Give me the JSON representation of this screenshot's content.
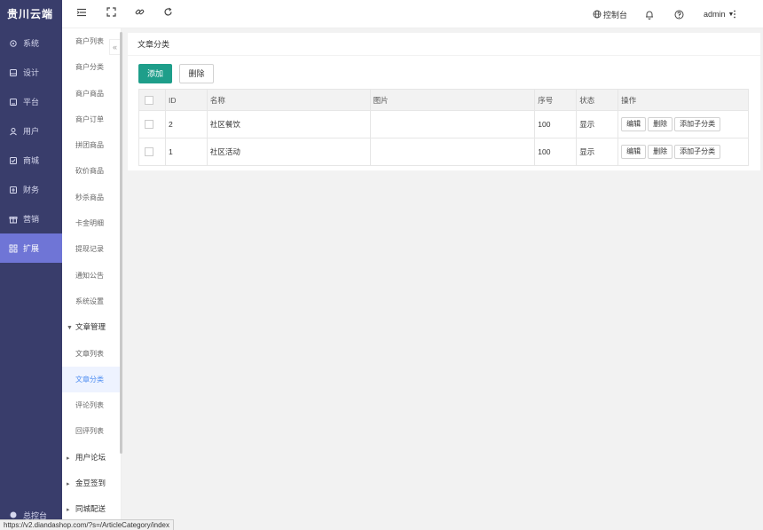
{
  "brand": "贵川云端",
  "nav": {
    "items": [
      {
        "label": "系统",
        "icon": "settings-icon"
      },
      {
        "label": "设计",
        "icon": "design-icon"
      },
      {
        "label": "平台",
        "icon": "platform-icon"
      },
      {
        "label": "用户",
        "icon": "user-icon"
      },
      {
        "label": "商城",
        "icon": "shop-icon"
      },
      {
        "label": "财务",
        "icon": "finance-icon"
      },
      {
        "label": "营销",
        "icon": "gift-icon"
      },
      {
        "label": "扩展",
        "icon": "apps-icon"
      }
    ],
    "bottom_label": "总控台"
  },
  "submenu": {
    "items": [
      "商户列表",
      "商户分类",
      "商户商品",
      "商户订单",
      "拼团商品",
      "砍价商品",
      "秒杀商品",
      "卡金明细",
      "提现记录",
      "通知公告",
      "系统设置"
    ],
    "group_article": "文章管理",
    "article_items": [
      "文章列表",
      "文章分类",
      "评论列表",
      "回评列表"
    ],
    "group_forum": "用户论坛",
    "group_signin": "金豆签到",
    "group_next": "同城配送"
  },
  "topbar": {
    "console_label": "控制台",
    "user_label": "admin"
  },
  "panel": {
    "title": "文章分类",
    "add_label": "添加",
    "delete_label": "删除"
  },
  "table": {
    "headers": {
      "id": "ID",
      "name": "名称",
      "image": "图片",
      "order": "序号",
      "status": "状态",
      "ops": "操作"
    },
    "rows": [
      {
        "id": "2",
        "name": "社区餐饮",
        "image": "",
        "order": "100",
        "status": "显示"
      },
      {
        "id": "1",
        "name": "社区活动",
        "image": "",
        "order": "100",
        "status": "显示"
      }
    ],
    "op_edit": "编辑",
    "op_delete": "删除",
    "op_add_child": "添加子分类"
  },
  "statusbar_url": "https://v2.diandashop.com/?s=/ArticleCategory/index",
  "colors": {
    "sidebar": "#393d6b",
    "active_nav": "#6f75d6",
    "primary": "#1e9e8a",
    "status_on": "#1e9e1e"
  }
}
